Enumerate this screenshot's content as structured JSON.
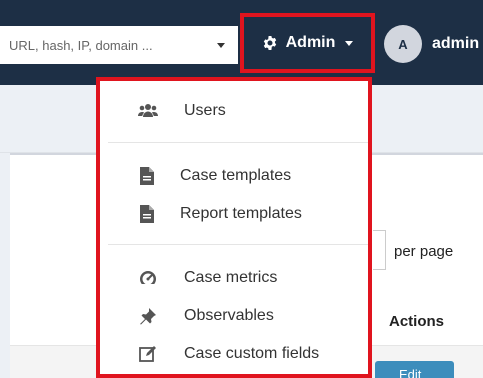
{
  "colors": {
    "navbar_bg": "#1d2f45",
    "highlight_border": "#e0141e",
    "accent": "#3c8dbc"
  },
  "navbar": {
    "search": {
      "placeholder": "URL, hash, IP, domain ...",
      "icon": "caret-down-icon"
    },
    "admin_menu": {
      "icon": "gear-icon",
      "label": "Admin",
      "caret": "caret-down-icon"
    },
    "user": {
      "avatar_initial": "A",
      "name": "admin"
    }
  },
  "dropdown": {
    "groups": [
      [
        {
          "icon": "users-icon",
          "label": "Users"
        }
      ],
      [
        {
          "icon": "file-icon",
          "label": "Case templates"
        },
        {
          "icon": "file-icon",
          "label": "Report templates"
        }
      ],
      [
        {
          "icon": "dashboard-icon",
          "label": "Case metrics"
        },
        {
          "icon": "thumbtack-icon",
          "label": "Observables"
        },
        {
          "icon": "edit-icon",
          "label": "Case custom fields"
        }
      ]
    ]
  },
  "background": {
    "per_page_label": "per page",
    "actions_header": "Actions",
    "edit_button_label": "Edit"
  }
}
